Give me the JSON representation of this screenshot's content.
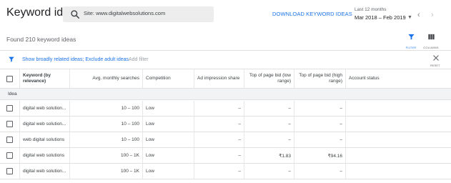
{
  "header": {
    "title": "Keyword ideas",
    "search_text": "Site: www.digitalwebsolutions.com",
    "download_label": "DOWNLOAD KEYWORD IDEAS",
    "date_range_label": "Last 12 months",
    "date_range_value": "Mar 2018 – Feb 2019"
  },
  "summary": {
    "found_text": "Found 210 keyword ideas",
    "filter_label": "FILTER",
    "columns_label": "COLUMNS"
  },
  "filter_bar": {
    "link_text": "Show broadly related ideas; Exclude adult ideas",
    "add_filter": "Add filter",
    "reset_label": "RESET"
  },
  "table": {
    "headers": {
      "keyword": "Keyword (by relevance)",
      "searches": "Avg. monthly searches",
      "competition": "Competition",
      "impression": "Ad impression share",
      "bid_low": "Top of page bid (low range)",
      "bid_high": "Top of page bid (high range)",
      "status": "Account status"
    },
    "group_label": "Idea",
    "rows": [
      {
        "keyword": "digital web solution...",
        "searches": "10 – 100",
        "competition": "Low",
        "impression": "–",
        "bid_low": "–",
        "bid_high": "–",
        "status": ""
      },
      {
        "keyword": "digital web solution...",
        "searches": "10 – 100",
        "competition": "Low",
        "impression": "–",
        "bid_low": "–",
        "bid_high": "–",
        "status": ""
      },
      {
        "keyword": "web digital solutions",
        "searches": "10 – 100",
        "competition": "Low",
        "impression": "–",
        "bid_low": "–",
        "bid_high": "–",
        "status": ""
      },
      {
        "keyword": "digital web solutions",
        "searches": "100 – 1K",
        "competition": "Low",
        "impression": "–",
        "bid_low": "₹1.83",
        "bid_high": "₹94.16",
        "status": ""
      },
      {
        "keyword": "digital web solution...",
        "searches": "100 – 1K",
        "competition": "Low",
        "impression": "–",
        "bid_low": "–",
        "bid_high": "–",
        "status": ""
      }
    ]
  },
  "colors": {
    "accent": "#1a73e8",
    "group_bg": "#f1f3f4",
    "search_bg": "#ededed"
  }
}
